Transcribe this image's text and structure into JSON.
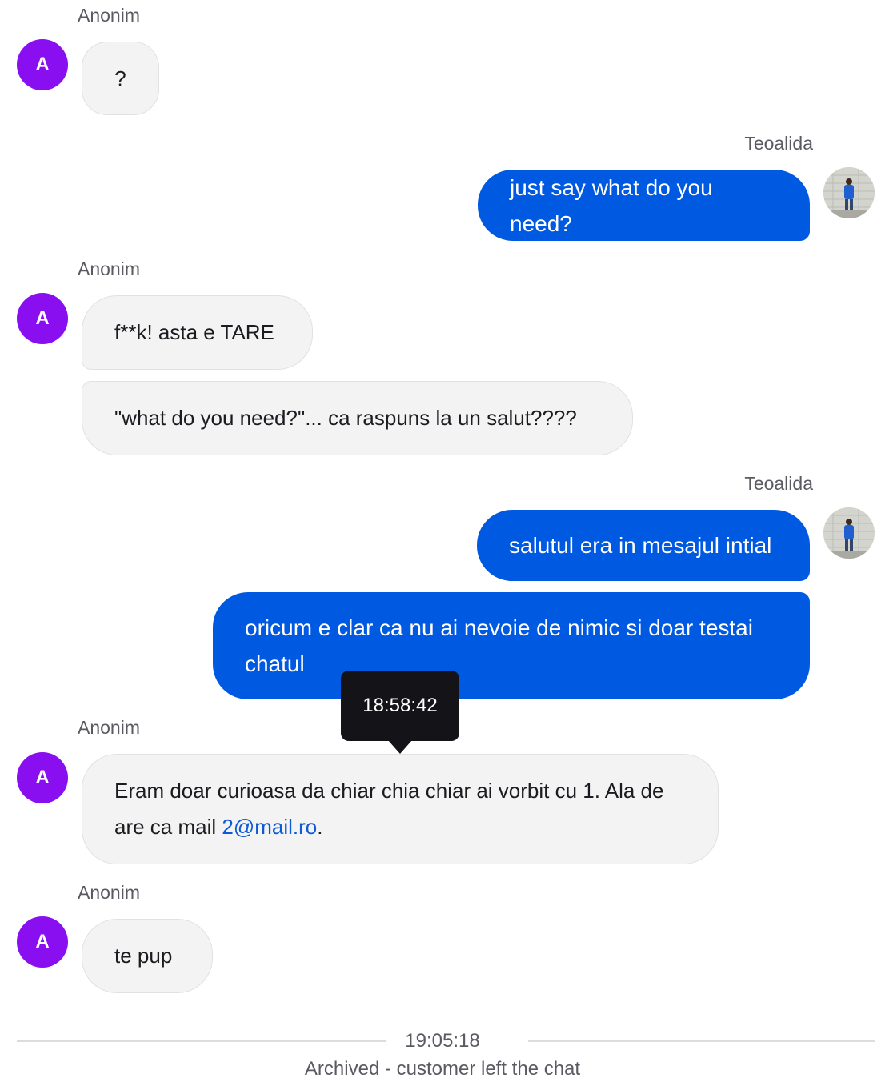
{
  "messages": [
    {
      "sender": "Anonim",
      "avatar_initial": "A",
      "text": "?"
    },
    {
      "sender": "Teoalida",
      "text": "just say what do you need?"
    },
    {
      "sender": "Anonim",
      "avatar_initial": "A",
      "text": "f**k! asta e TARE"
    },
    {
      "text": "\"what do you need?\"... ca raspuns la un salut????"
    },
    {
      "sender": "Teoalida",
      "text": "salutul era in mesajul intial"
    },
    {
      "text": "oricum e clar ca nu ai nevoie de nimic si doar testai chatul"
    },
    {
      "sender": "Anonim",
      "avatar_initial": "A",
      "text_before_link": "Eram doar curioasa da chiar chia chiar ai vorbit cu 1. Ala de are ca mail ",
      "link_text": "2@mail.ro",
      "text_after_link": "."
    },
    {
      "sender": "Anonim",
      "avatar_initial": "A",
      "text": "te pup"
    }
  ],
  "tooltip": {
    "time": "18:58:42"
  },
  "footer": {
    "time": "19:05:18",
    "status": "Archived - customer left the chat"
  },
  "colors": {
    "agent_bubble": "#0059e1",
    "customer_bubble": "#f3f3f4",
    "customer_avatar": "#8a0ff0",
    "link": "#0c5ad6"
  }
}
